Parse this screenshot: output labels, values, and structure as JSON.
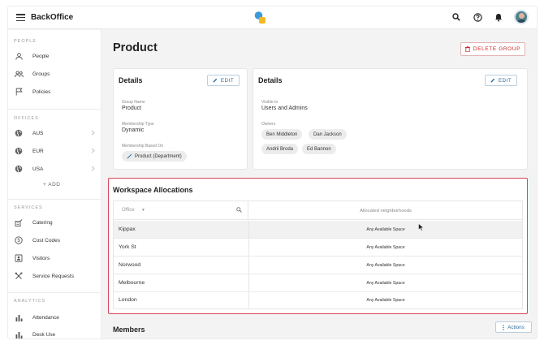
{
  "app": {
    "title": "BackOffice"
  },
  "topbar": {
    "icons": [
      "menu-icon",
      "search-icon",
      "help-icon",
      "bell-icon",
      "avatar"
    ]
  },
  "sidebar": {
    "sections": [
      {
        "title": "PEOPLE",
        "items": [
          {
            "label": "People",
            "icon": "person-icon"
          },
          {
            "label": "Groups",
            "icon": "groups-icon"
          },
          {
            "label": "Policies",
            "icon": "flag-icon"
          }
        ]
      },
      {
        "title": "OFFICES",
        "items": [
          {
            "label": "AUS",
            "icon": "globe-icon"
          },
          {
            "label": "EUR",
            "icon": "globe-icon"
          },
          {
            "label": "USA",
            "icon": "globe-icon"
          }
        ],
        "add_label": "+ ADD"
      },
      {
        "title": "SERVICES",
        "items": [
          {
            "label": "Catering",
            "icon": "catering-icon"
          },
          {
            "label": "Cost Codes",
            "icon": "dollar-icon"
          },
          {
            "label": "Visitors",
            "icon": "badge-icon"
          },
          {
            "label": "Service Requests",
            "icon": "tools-icon"
          }
        ]
      },
      {
        "title": "ANALYTICS",
        "items": [
          {
            "label": "Attendance",
            "icon": "bar-chart-icon"
          },
          {
            "label": "Desk Use",
            "icon": "bar-chart-icon"
          }
        ]
      }
    ]
  },
  "page": {
    "title": "Product",
    "delete_label": "DELETE GROUP"
  },
  "details_left": {
    "title": "Details",
    "edit_label": "EDIT",
    "fields": [
      {
        "label": "Group Name",
        "value": "Product"
      },
      {
        "label": "Membership Type",
        "value": "Dynamic"
      },
      {
        "label": "Membership Based On",
        "value": "Product (Department)"
      }
    ]
  },
  "details_right": {
    "title": "Details",
    "edit_label": "EDIT",
    "visible_label": "Visible to",
    "visible_value": "Users and Admins",
    "owners_label": "Owners",
    "owners": [
      "Ben Middleton",
      "Dan Jackson",
      "Andrii Broda",
      "Ed Bannon"
    ]
  },
  "workspace": {
    "title": "Workspace Allocations",
    "filter_label": "Office",
    "column_header": "Allocated neighborhoods",
    "rows": [
      {
        "office": "Kippax",
        "neighborhood": "Any Available Space"
      },
      {
        "office": "York St",
        "neighborhood": "Any Available Space"
      },
      {
        "office": "Norwood",
        "neighborhood": "Any Available Space"
      },
      {
        "office": "Melbourne",
        "neighborhood": "Any Available Space"
      },
      {
        "office": "London",
        "neighborhood": "Any Available Space"
      }
    ]
  },
  "members": {
    "title": "Members",
    "actions_label": "Actions"
  },
  "colors": {
    "accent": "#2a6a9c",
    "danger": "#c62828",
    "highlight_border": "#d9455a"
  }
}
